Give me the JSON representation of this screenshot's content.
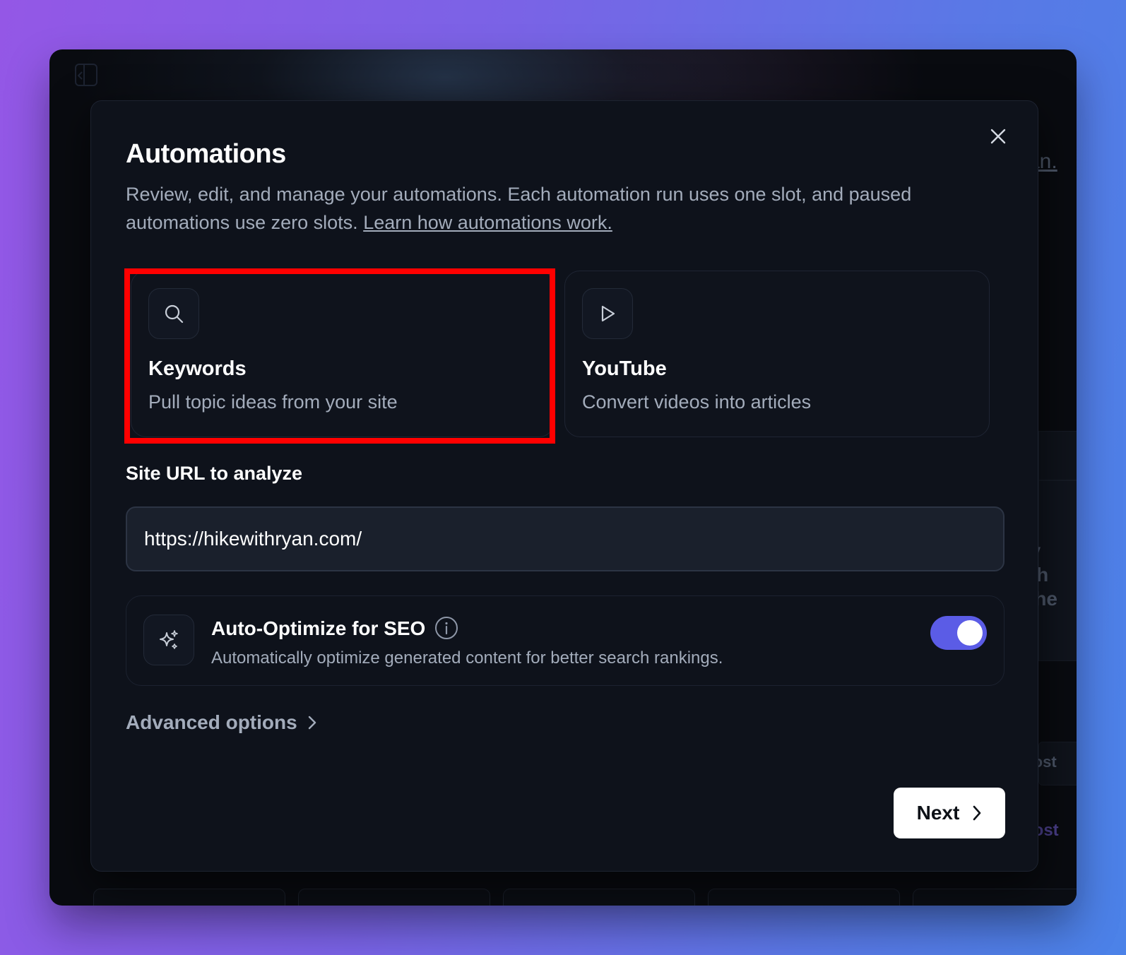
{
  "background_page": {
    "partial_texts": [
      "yan.",
      "u",
      "sy",
      "ith",
      "the",
      "Post",
      "post"
    ]
  },
  "modal": {
    "title": "Automations",
    "description": "Review, edit, and manage your automations. Each automation run uses one slot, and paused automations use zero slots.",
    "learn_link": "Learn how automations work.",
    "cards": [
      {
        "title": "Keywords",
        "subtitle": "Pull topic ideas from your site",
        "icon": "search-icon",
        "selected": true
      },
      {
        "title": "YouTube",
        "subtitle": "Convert videos into articles",
        "icon": "play-icon",
        "selected": false
      }
    ],
    "url_label": "Site URL to analyze",
    "url_value": "https://hikewithryan.com/",
    "seo": {
      "title": "Auto-Optimize for SEO",
      "subtitle": "Automatically optimize generated content for better search rankings.",
      "enabled": true,
      "icon": "sparkles-icon"
    },
    "advanced_label": "Advanced options",
    "next_label": "Next"
  },
  "colors": {
    "toggle_on": "#5b5ce6",
    "highlight": "#ff0000",
    "modal_bg": "#0e121b"
  }
}
